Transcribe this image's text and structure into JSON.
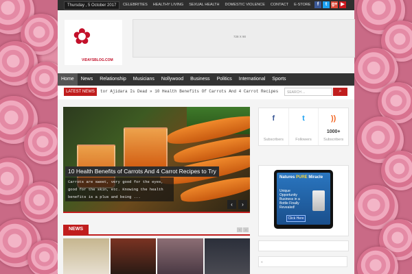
{
  "topbar": {
    "date": "Thursday , 5 October 2017",
    "links": [
      "Celebrities",
      "Healthy Living",
      "Sexual Health",
      "Domestic Violence",
      "Contact",
      "E-Store"
    ],
    "social_icons": [
      {
        "name": "facebook-icon",
        "glyph": "f",
        "color": "#3b5998"
      },
      {
        "name": "twitter-icon",
        "glyph": "t",
        "color": "#1da1f2"
      },
      {
        "name": "google-plus-icon",
        "glyph": "g+",
        "color": "#dd4b39"
      },
      {
        "name": "youtube-icon",
        "glyph": "▶",
        "color": "#cc181e"
      }
    ]
  },
  "header": {
    "logo_text": "VIDAYSBLOG.COM",
    "ad_label": "728 X 90"
  },
  "nav": {
    "items": [
      "Home",
      "News",
      "Relationship",
      "Musicians",
      "Nollywood",
      "Business",
      "Politics",
      "International",
      "Sports"
    ]
  },
  "ticker": {
    "label": "Latest News",
    "text": "tor Ajidara Is Dead  » 10 Health Benefits Of Carrots And 4 Carrot Recipes",
    "search_placeholder": "SEARCH ..."
  },
  "slider": {
    "title": "10 Health Benefits of Carrots And 4 Carrot Recipes to Try",
    "desc": "Carrots are sweet, very good for the eyes, good for the skin, etc. Knowing the health benefits is a plus and being ...",
    "prev": "‹",
    "next": "›"
  },
  "news_section": {
    "label": "News",
    "pager": [
      "‹",
      "›"
    ],
    "thumb_colors": [
      "#c6b68f",
      "#7a3322",
      "#8c6e74",
      "#2b2f3a"
    ]
  },
  "sidebar": {
    "social": [
      {
        "name": "facebook",
        "icon": "f",
        "color": "#3b5998",
        "count": "",
        "label": "Subscribers"
      },
      {
        "name": "twitter",
        "icon": "t",
        "color": "#1da1f2",
        "count": "",
        "label": "Followers"
      },
      {
        "name": "rss",
        "icon": "))",
        "color": "#f26522",
        "count": "1000+",
        "label": "Subscribers"
      }
    ],
    "ad": {
      "title_1": "Natures ",
      "title_2": "PURE",
      "title_3": " Miracle",
      "body": "Unique Opportunity Business in a Bottle Finally Revealed!",
      "cta": "Click Here"
    },
    "box3_text": "«"
  }
}
